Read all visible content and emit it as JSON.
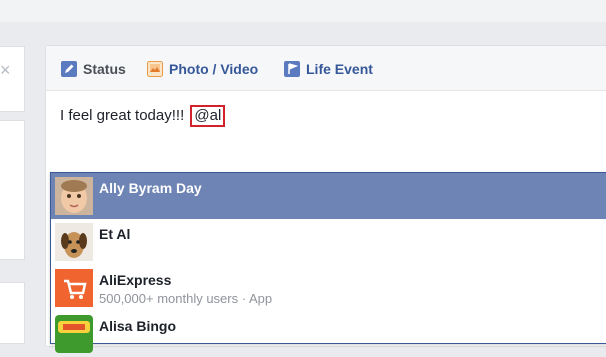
{
  "composer": {
    "tabs": [
      {
        "label": "Status",
        "icon": "pencil-icon"
      },
      {
        "label": "Photo / Video",
        "icon": "photo-icon"
      },
      {
        "label": "Life Event",
        "icon": "flag-icon"
      }
    ],
    "status_text": "I feel great today!!!",
    "mention_query": "@al"
  },
  "suggestions": [
    {
      "name": "Ally Byram Day",
      "subtitle": "",
      "selected": true,
      "avatar": "child-photo"
    },
    {
      "name": "Et Al",
      "subtitle": "",
      "selected": false,
      "avatar": "dog-photo"
    },
    {
      "name": "AliExpress",
      "subtitle": "500,000+ monthly users · App",
      "selected": false,
      "avatar": "aliexpress-cart-icon"
    },
    {
      "name": "Alisa Bingo",
      "subtitle": "",
      "selected": false,
      "avatar": "bingo-app-icon"
    }
  ],
  "colors": {
    "selected_row": "#6d84b4",
    "link_blue": "#365899",
    "mention_outline": "#d3222a",
    "aliexpress_orange": "#f0652f"
  }
}
